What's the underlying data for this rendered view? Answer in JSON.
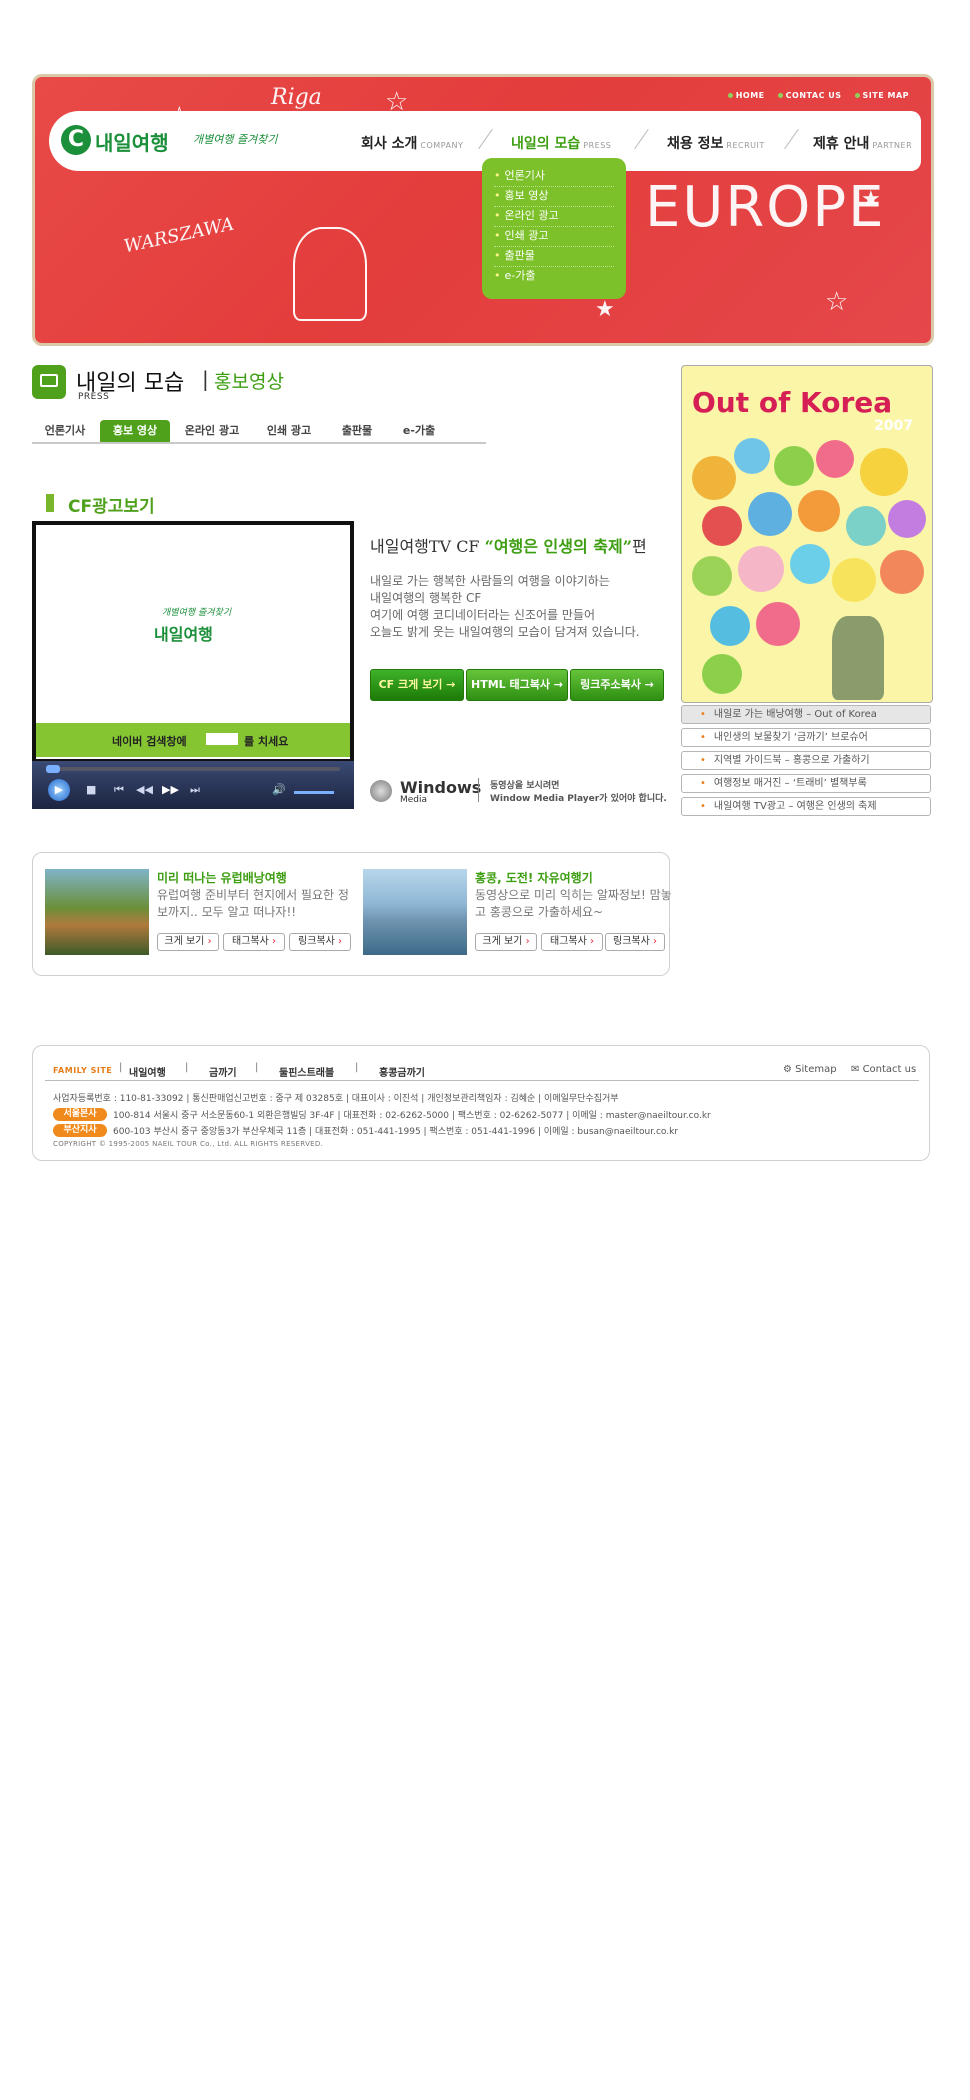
{
  "header": {
    "util_links": [
      "HOME",
      "CONTAC US",
      "SITE MAP"
    ],
    "logo_text": "내일여행",
    "slogan": "개별여행 즐겨찾기",
    "menu": [
      {
        "label": "회사 소개",
        "sub": "COMPANY"
      },
      {
        "label": "내일의 모습",
        "sub": "PRESS"
      },
      {
        "label": "채용 정보",
        "sub": "RECRUIT"
      },
      {
        "label": "제휴 안내",
        "sub": "PARTNER"
      }
    ],
    "dropdown": [
      "언론기사",
      "홍보 영상",
      "온라인 광고",
      "인쇄 광고",
      "출판물",
      "e-가출"
    ],
    "doodle": {
      "riga": "Riga",
      "europe": "EUROPE",
      "warszawa": "WARSZAWA"
    }
  },
  "page": {
    "title": "내일의 모습",
    "separator": "|",
    "subtitle": "홍보영상",
    "title_en": "PRESS",
    "tabs": [
      "언론기사",
      "홍보 영상",
      "온라인 광고",
      "인쇄 광고",
      "출판물",
      "e-가출"
    ],
    "active_tab": "홍보 영상"
  },
  "cf": {
    "heading": "CF광고보기",
    "player": {
      "slogan": "개별여행 즐겨찾기",
      "logo": "내일여행",
      "naver_text": "네이버  검색창에",
      "naver_after": "를 치세요"
    },
    "title_prefix": "내일여행TV CF ",
    "title_quote": "“여행은 인생의 축제”",
    "title_suffix": "편",
    "desc": [
      "내일로 가는 행복한 사람들의 여행을 이야기하는",
      "내일여행의 행복한 CF",
      "여기에 여행 코디네이터라는 신조어를 만들어",
      "오늘도  밝게 웃는 내일여행의 모습이 담겨져 있습니다."
    ],
    "buttons": [
      "CF 크게 보기 →",
      "HTML 태그복사 →",
      "링크주소복사 →"
    ],
    "wm_title": "Windows",
    "wm_sub": "Media",
    "wm_note": [
      "동영상을 보시려면",
      "Window Media Player가 있어야 합니다."
    ]
  },
  "sidebar": {
    "book_title": "Out of Korea",
    "book_year": "2007",
    "links": [
      "내일로 가는 배낭여행 – Out of Korea",
      "내인생의 보물찾기 ‘금까기’  브로슈어",
      "지역별 가이드북 – 홍콩으로 가출하기",
      "여행정보 매거진 – ‘트래비’  별책부록",
      "내일여행 TV광고 – 여행은 인생의 축제"
    ]
  },
  "promo": [
    {
      "title": "미리 떠나는 유럽배낭여행",
      "desc": "유럽여행 준비부터 현지에서 필요한 정보까지.. 모두 알고 떠나자!!",
      "buttons": [
        "크게 보기",
        "태그복사",
        "링크복사"
      ]
    },
    {
      "title": "홍콩, 도전! 자유여행기",
      "desc": "동영상으로 미리 익히는 알짜정보! 맘놓고 홍콩으로 가출하세요~",
      "buttons": [
        "크게 보기",
        "태그복사",
        "링크복사"
      ]
    }
  ],
  "footer": {
    "family_label": "FAMILY SITE",
    "family_sites": [
      "내일여행",
      "금까기",
      "둘핀스트래블",
      "홍콩금까기"
    ],
    "sitemap": "Sitemap",
    "contact": "Contact us",
    "company_info": "사업자등록번호 : 110-81-33092 | 통신판매업신고번호 : 중구 제 03285호 | 대표이사 : 이진석 | 개인정보관리책임자 : 김혜순 | 이메일무단수집거부",
    "seoul_label": "서울본사",
    "seoul_info": "100-814 서울시 중구 서소문동60-1 외환은행빌딩 3F-4F | 대표전화 : 02-6262-5000 | 팩스번호 : 02-6262-5077 | 이메일 : master@naeiltour.co.kr",
    "busan_label": "부산지사",
    "busan_info": "600-103 부산시 중구 중앙동3가 부산우체국 11층 | 대표전화 : 051-441-1995 | 팩스번호 : 051-441-1996 | 이메일 : busan@naeiltour.co.kr",
    "copyright": "COPYRIGHT © 1995-2005 NAEIL TOUR Co., Ltd. ALL RIGHTS RESERVED."
  },
  "colors": {
    "accent_green": "#4fa11c",
    "banner_red": "#e84a47",
    "branch_orange": "#f08a1c",
    "quote_green": "#3d9e12"
  }
}
